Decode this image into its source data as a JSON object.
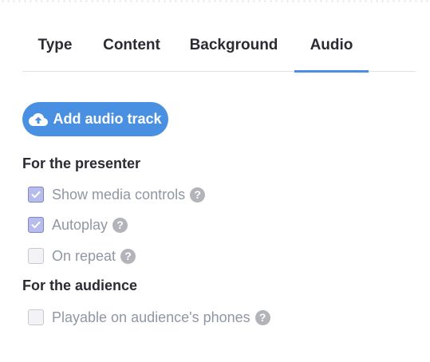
{
  "tabs": [
    {
      "label": "Type",
      "active": false
    },
    {
      "label": "Content",
      "active": false
    },
    {
      "label": "Background",
      "active": false
    },
    {
      "label": "Audio",
      "active": true
    }
  ],
  "add_audio": {
    "label": "Add audio track",
    "icon": "cloud-upload-icon"
  },
  "presenter": {
    "title": "For the presenter",
    "options": [
      {
        "label": "Show media controls",
        "checked": true,
        "help": "?"
      },
      {
        "label": "Autoplay",
        "checked": true,
        "help": "?"
      },
      {
        "label": "On repeat",
        "checked": false,
        "help": "?"
      }
    ]
  },
  "audience": {
    "title": "For the audience",
    "options": [
      {
        "label": "Playable on audience's phones",
        "checked": false,
        "help": "?"
      }
    ]
  },
  "colors": {
    "accent": "#4a90e2",
    "checkbox_checked": "#b7bcea",
    "label_text": "#9096a4",
    "help_icon": "#b3b3ba"
  }
}
